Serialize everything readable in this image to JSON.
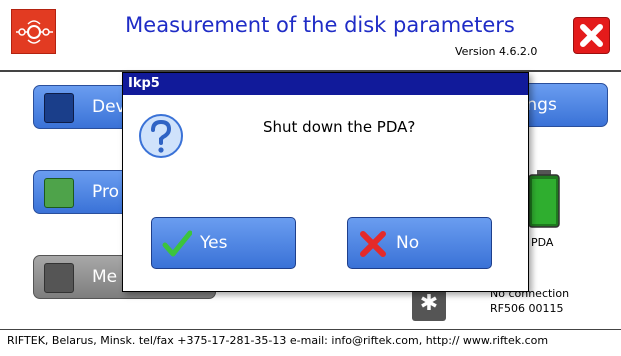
{
  "header": {
    "title": "Measurement of the disk parameters",
    "version": "Version 4.6.2.0"
  },
  "main": {
    "devices_label": "Dev",
    "settings_label": "tings",
    "process_label": "Pro",
    "measure_label": "Me",
    "battery_label": "PDA",
    "connection_status": "No connection",
    "device_id": "RF506 00115"
  },
  "footer": {
    "text": "RIFTEK, Belarus, Minsk.  tel/fax +375-17-281-35-13  e-mail: info@riftek.com, http:// www.riftek.com"
  },
  "dialog": {
    "title": "Ikp5",
    "message": "Shut down the PDA?",
    "yes_label": "Yes",
    "no_label": "No"
  },
  "colors": {
    "accent_blue": "#3a72d7",
    "title_blue": "#1f2cc6",
    "dialog_title_bg": "#111a9a",
    "close_red": "#e41b1b",
    "battery_green": "#2fae2f"
  },
  "icons": [
    "logo-icon",
    "close-icon",
    "devices-icon",
    "process-icon",
    "measure-icon",
    "battery-icon",
    "bluetooth-icon",
    "question-icon",
    "check-icon",
    "x-icon"
  ]
}
